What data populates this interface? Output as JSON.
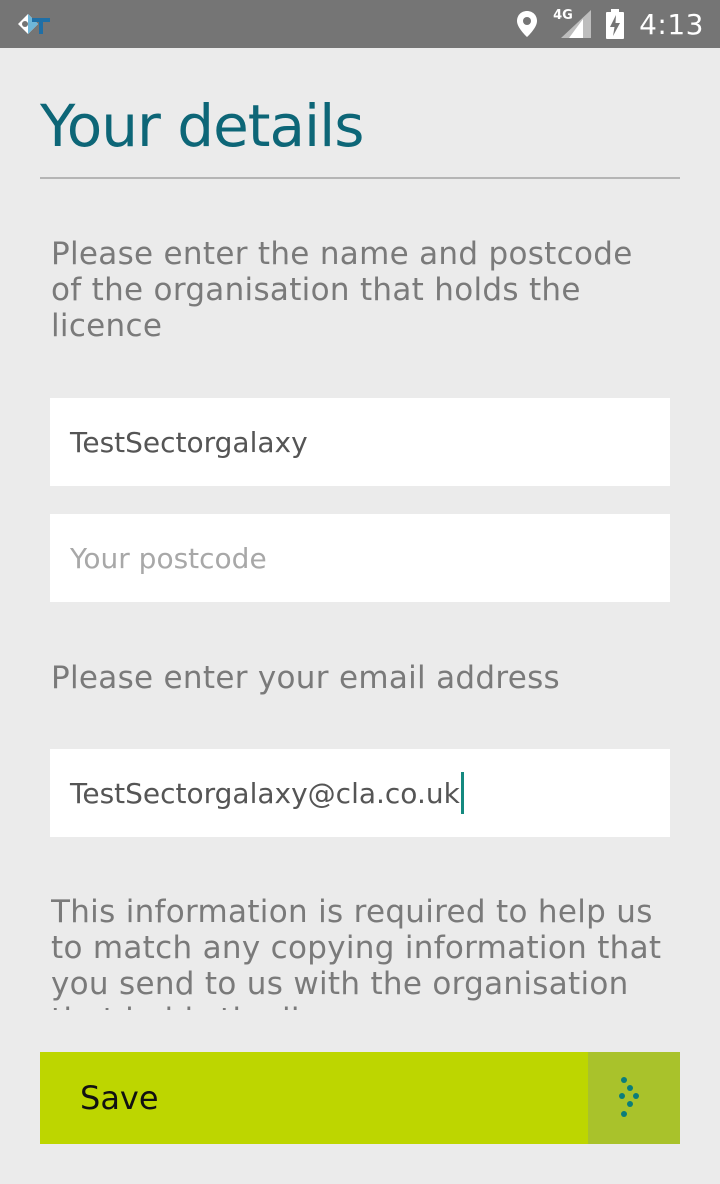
{
  "status_bar": {
    "time": "4:13",
    "network_label": "4G",
    "app_icon": "app-notification-icon",
    "location_icon": "location-pin-icon",
    "signal_icon": "cell-signal-icon",
    "battery_icon": "battery-charging-icon"
  },
  "header": {
    "title": "Your details"
  },
  "organisation": {
    "instruction": "Please enter the name and postcode of the organisation that holds the licence",
    "name_value": "TestSectorgalaxy",
    "postcode_value": "",
    "postcode_placeholder": "Your postcode"
  },
  "email": {
    "instruction": "Please enter your email address",
    "value": "TestSectorgalaxy@cla.co.uk"
  },
  "info": {
    "text": "This information is required to help us to match any copying information that you send to us with the organisation that holds the licence"
  },
  "save_button": {
    "label": "Save",
    "icon": "dotted-arrow-right-icon"
  },
  "colors": {
    "status_bar": "#757575",
    "background": "#ebebeb",
    "title": "#0d6677",
    "button": "#bdd600",
    "button_icon_bg": "#a9c22b",
    "caret": "#14897f"
  }
}
